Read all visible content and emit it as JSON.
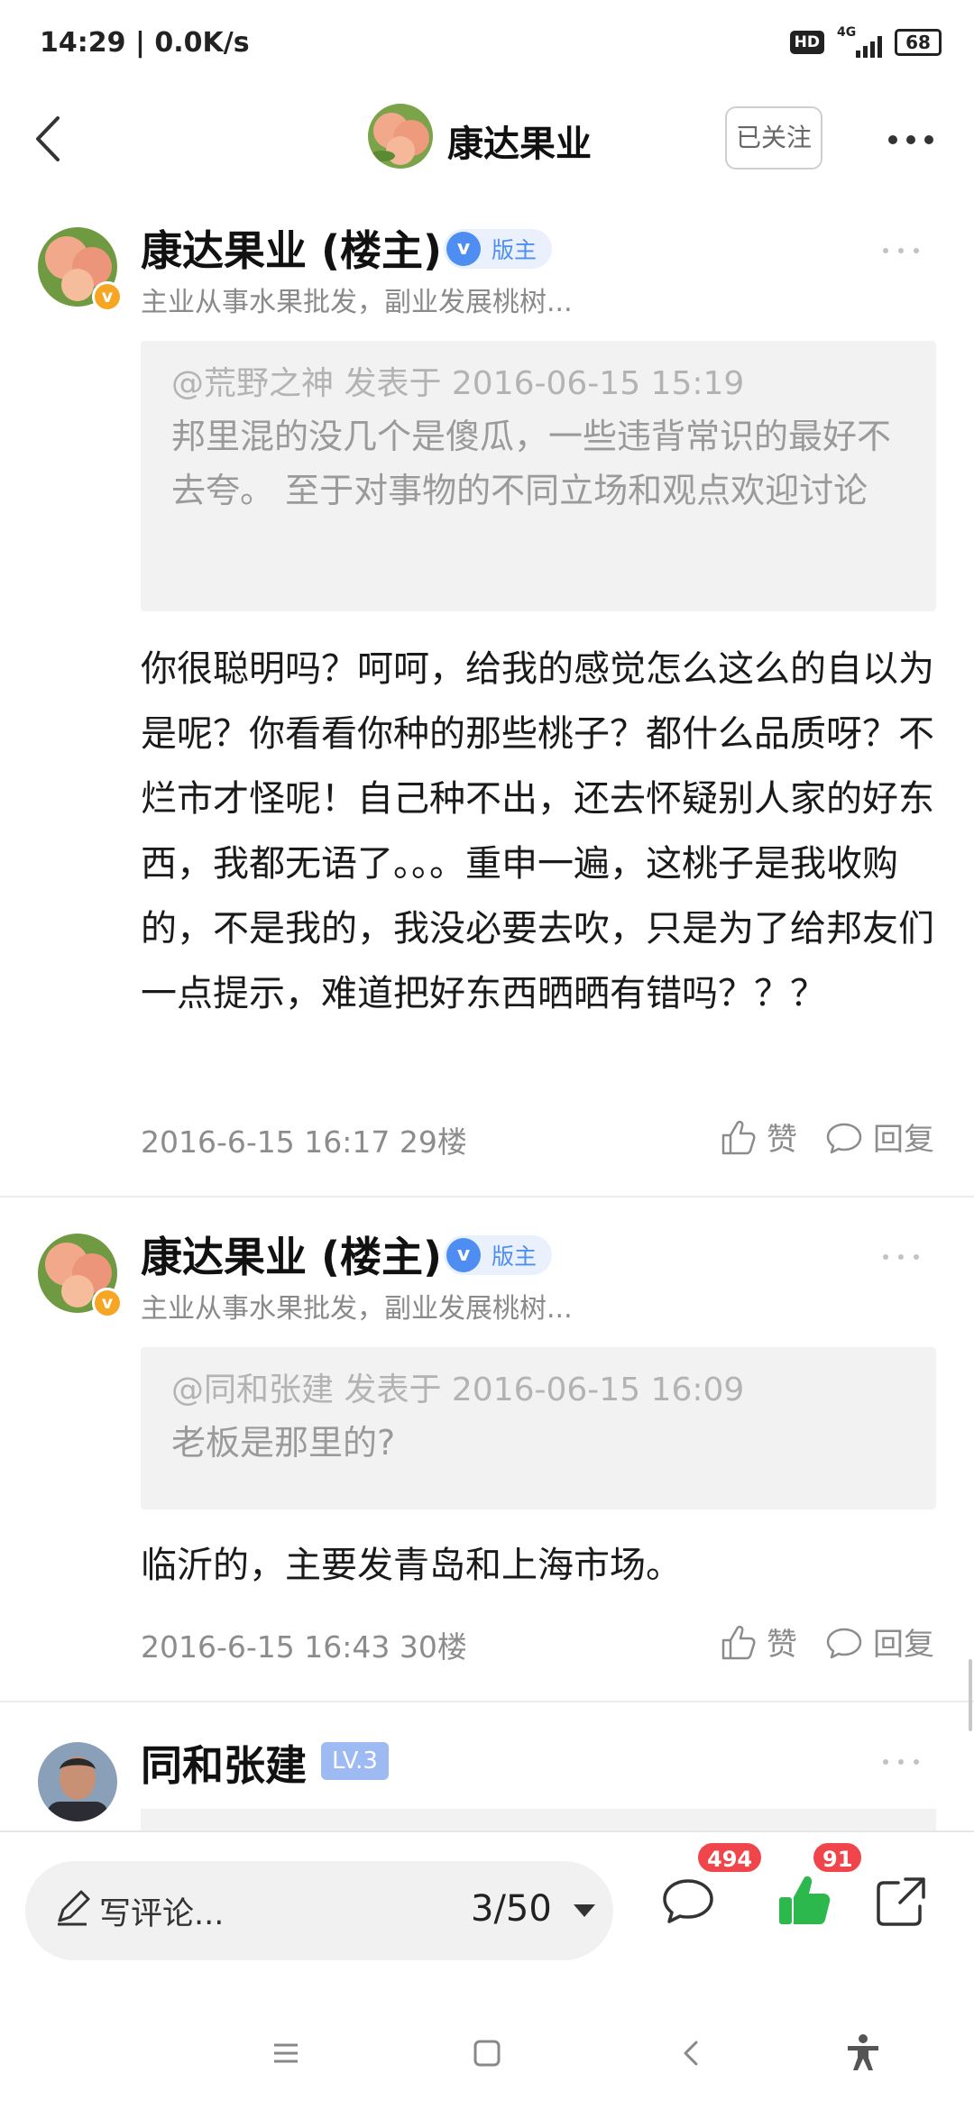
{
  "status_bar": {
    "time": "14:29 | 0.0K/s",
    "hd": "HD",
    "network": "4G",
    "battery": "68"
  },
  "nav": {
    "title": "康达果业",
    "follow_label": "已关注"
  },
  "posts": [
    {
      "author": "康达果业 (楼主)",
      "role_badge": "版主",
      "bio": "主业从事水果批发，副业发展桃树...",
      "quote_head": "@荒野之神 发表于 2016-06-15 15:19",
      "quote_body": "邦里混的没几个是傻瓜，一些违背常识的最好不去夸。 至于对事物的不同立场和观点欢迎讨论",
      "body": "你很聪明吗？呵呵，给我的感觉怎么这么的自以为是呢？你看看你种的那些桃子？都什么品质呀？不烂市才怪呢！自己种不出，还去怀疑别人家的好东西，我都无语了。。。重申一遍，这桃子是我收购的，不是我的，我没必要去吹，只是为了给邦友们一点提示，难道把好东西晒晒有错吗？？？",
      "meta": "2016-6-15 16:17  29楼",
      "like_label": "赞",
      "reply_label": "回复"
    },
    {
      "author": "康达果业 (楼主)",
      "role_badge": "版主",
      "bio": "主业从事水果批发，副业发展桃树...",
      "quote_head": "@同和张建 发表于 2016-06-15 16:09",
      "quote_body": "老板是那里的?",
      "body": "临沂的，主要发青岛和上海市场。",
      "meta": "2016-6-15 16:43  30楼",
      "like_label": "赞",
      "reply_label": "回复"
    },
    {
      "author": "同和张建",
      "level_badge": "LV.3"
    }
  ],
  "bottom_bar": {
    "comment_placeholder": "写评论...",
    "page_indicator": "3/50",
    "comment_count": "494",
    "like_count": "91"
  },
  "colors": {
    "accent_blue": "#4e8ef2",
    "badge_red": "#f0454a",
    "like_green": "#2db84d",
    "level_blue": "#9dbbf2"
  },
  "icons": [
    "back-icon",
    "more-icon",
    "like-icon",
    "reply-icon",
    "pencil-icon",
    "comment-icon",
    "thumbs-up-icon",
    "share-icon",
    "menu-icon",
    "home-icon",
    "back-nav-icon",
    "accessibility-icon"
  ]
}
